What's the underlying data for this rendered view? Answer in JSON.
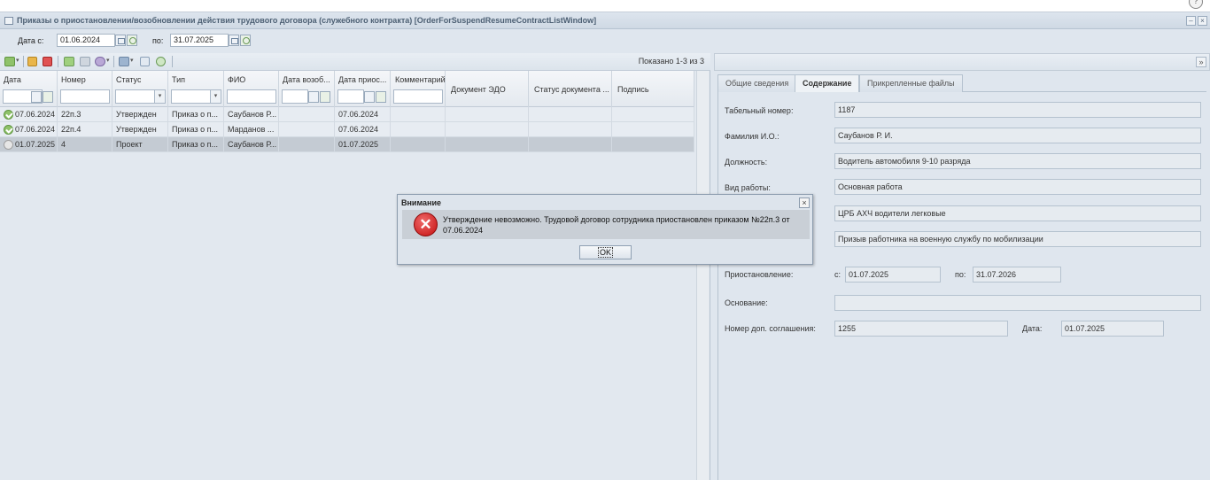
{
  "window": {
    "title": "Приказы о приостановлении/возобновлении действия трудового договора (служебного контракта) [OrderForSuspendResumeContractListWindow]",
    "minimize": "–",
    "close": "×",
    "help": "?"
  },
  "filter": {
    "date_from_label": "Дата с:",
    "date_from": "01.06.2024",
    "date_to_label": "по:",
    "date_to": "31.07.2025"
  },
  "toolbar": {
    "shown_text": "Показано 1-3 из 3",
    "icons": [
      "add-icon",
      "edit-icon",
      "delete-icon",
      "approve-icon",
      "unapprove-icon",
      "sign-icon",
      "print-icon",
      "export-icon",
      "refresh-icon"
    ]
  },
  "grid": {
    "columns": [
      "Дата",
      "Номер",
      "Статус",
      "Тип",
      "ФИО",
      "Дата возоб...",
      "Дата приос...",
      "Комментарий",
      "Документ ЭДО",
      "Статус документа ...",
      "Подпись"
    ],
    "rows": [
      {
        "status_icon": "approved",
        "date": "07.06.2024",
        "number": "22п.3",
        "status": "Утвержден",
        "type": "Приказ о п...",
        "fio": "Саубанов Р...",
        "resume_date": "",
        "suspend_date": "07.06.2024",
        "comment": "",
        "edo": "",
        "doc_status": "",
        "signature": ""
      },
      {
        "status_icon": "approved",
        "date": "07.06.2024",
        "number": "22п.4",
        "status": "Утвержден",
        "type": "Приказ о п...",
        "fio": "Марданов ...",
        "resume_date": "",
        "suspend_date": "07.06.2024",
        "comment": "",
        "edo": "",
        "doc_status": "",
        "signature": ""
      },
      {
        "status_icon": "draft",
        "date": "01.07.2025",
        "number": "4",
        "status": "Проект",
        "type": "Приказ о п...",
        "fio": "Саубанов Р...",
        "resume_date": "",
        "suspend_date": "01.07.2025",
        "comment": "",
        "edo": "",
        "doc_status": "",
        "signature": ""
      }
    ]
  },
  "details": {
    "collapse": "»",
    "tabs": [
      "Общие сведения",
      "Содержание",
      "Прикрепленные файлы"
    ],
    "active_tab": "Содержание",
    "tab_number_label": "Табельный номер:",
    "tab_number": "1187",
    "fio_label": "Фамилия И.О.:",
    "fio": "Саубанов Р. И.",
    "position_label": "Должность:",
    "position": "Водитель автомобиля 9-10 разряда",
    "work_type_label": "Вид работы:",
    "work_type": "Основная работа",
    "department": "ЦРБ АХЧ водители легковые",
    "reason_text": "Призыв работника на военную службу по мобилизации",
    "suspension_label": "Приостановление:",
    "from_label": "с:",
    "suspension_from": "01.07.2025",
    "to_label": "по:",
    "suspension_to": "31.07.2026",
    "basis_label": "Основание:",
    "basis": "",
    "agreement_label": "Номер доп. соглашения:",
    "agreement_number": "1255",
    "date_label": "Дата:",
    "agreement_date": "01.07.2025"
  },
  "dialog": {
    "title": "Внимание",
    "close": "×",
    "icon": "error-icon",
    "message": "Утверждение невозможно. Трудовой договор сотрудника приостановлен приказом №22п.3 от 07.06.2024",
    "ok_label": "OK"
  },
  "colors": {
    "selected_row": "#c4cbd3",
    "error_red": "#c40f0f",
    "approved_green": "#8fc26a"
  }
}
